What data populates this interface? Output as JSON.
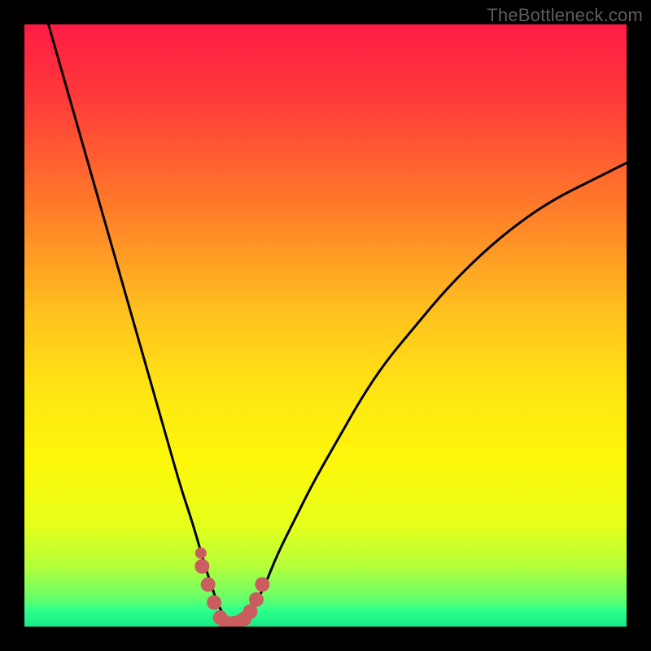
{
  "watermark": "TheBottleneck.com",
  "colors": {
    "frame": "#000000",
    "curve": "#000000",
    "marker": "#cb5d60",
    "gradient_stops": [
      {
        "offset": 0.0,
        "color": "#ff1b44"
      },
      {
        "offset": 0.12,
        "color": "#ff3a3a"
      },
      {
        "offset": 0.3,
        "color": "#ff7a2a"
      },
      {
        "offset": 0.48,
        "color": "#ffc21e"
      },
      {
        "offset": 0.62,
        "color": "#ffe812"
      },
      {
        "offset": 0.73,
        "color": "#fdf80a"
      },
      {
        "offset": 0.83,
        "color": "#e6ff1a"
      },
      {
        "offset": 0.9,
        "color": "#b4ff3a"
      },
      {
        "offset": 0.95,
        "color": "#6cff66"
      },
      {
        "offset": 0.975,
        "color": "#2bff8c"
      },
      {
        "offset": 1.0,
        "color": "#19e887"
      }
    ]
  },
  "chart_data": {
    "type": "line",
    "title": "",
    "xlabel": "",
    "ylabel": "",
    "xlim": [
      0,
      100
    ],
    "ylim": [
      0,
      100
    ],
    "note": "Axes are implicit (no tick labels shown). Values estimated from pixel positions; y is bottleneck-% (0 at bottom / green, 100 at top / red). The curve dips to ~0 around x≈32–37 then rises toward the right.",
    "series": [
      {
        "name": "bottleneck-curve",
        "x": [
          4,
          6,
          8,
          10,
          12,
          14,
          16,
          18,
          20,
          22,
          24,
          26,
          28,
          30,
          31,
          32,
          33,
          34,
          35,
          36,
          37,
          38,
          40,
          42,
          45,
          48,
          52,
          56,
          60,
          65,
          70,
          76,
          82,
          88,
          94,
          100
        ],
        "y": [
          100,
          93,
          86,
          79,
          72,
          65,
          58,
          51,
          44,
          37,
          30,
          23,
          17,
          10,
          7,
          4,
          2,
          0.5,
          0.3,
          0.5,
          1.5,
          3,
          7,
          12,
          18,
          24,
          31,
          38,
          44,
          50,
          56,
          62,
          67,
          71,
          74,
          77
        ]
      }
    ],
    "markers_dashed_region": {
      "name": "highlight-near-minimum",
      "x": [
        29.5,
        30.5,
        31.5,
        32.5,
        33.5,
        34.5,
        35.5,
        36.5,
        37.5,
        38.5,
        39.5
      ],
      "y": [
        10,
        7,
        4,
        1.5,
        0.6,
        0.5,
        0.7,
        1.3,
        2.5,
        4.5,
        7
      ]
    },
    "isolated_marker": {
      "x": 29.3,
      "y": 12.2
    },
    "background_scale": "vertical color gradient maps y-value: red (high bottleneck) at top → yellow mid → green (no bottleneck) at bottom"
  }
}
